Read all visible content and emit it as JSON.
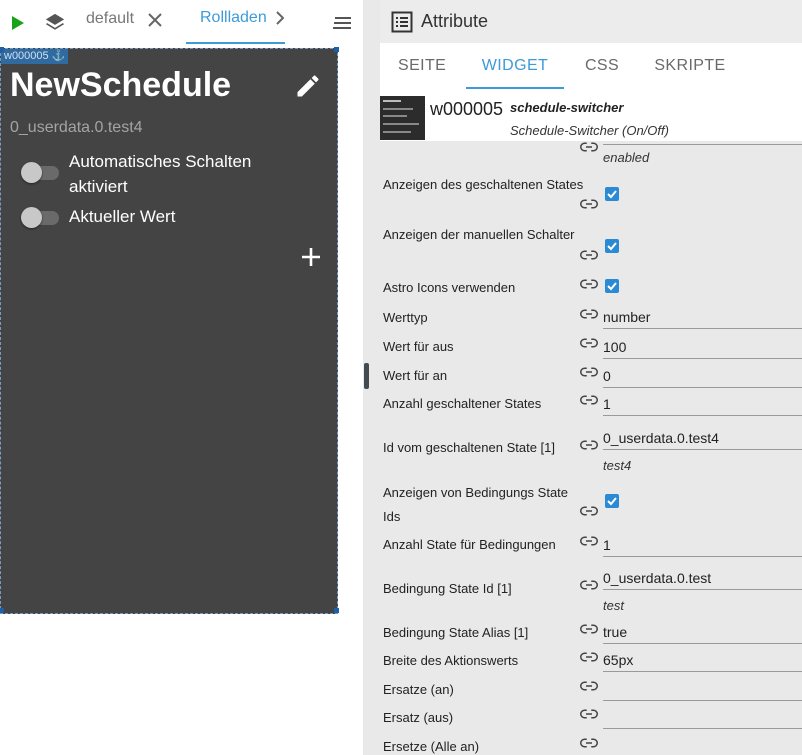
{
  "left": {
    "tabs": [
      {
        "label": "default",
        "closable": true,
        "active": false
      },
      {
        "label": "Rollladen",
        "active": true
      }
    ],
    "widget": {
      "tag": "w000005",
      "title": "NewSchedule",
      "subtitle": "0_userdata.0.test4",
      "toggles": [
        {
          "label": "Automatisches Schalten aktiviert",
          "on": false
        },
        {
          "label": "Aktueller Wert",
          "on": false
        }
      ]
    }
  },
  "right": {
    "title": "Attribute",
    "tabs": [
      "SEITE",
      "WIDGET",
      "CSS",
      "SKRIPTE"
    ],
    "active_tab": "WIDGET",
    "widget_id": "w000005",
    "widget_set": "schedule-switcher",
    "widget_name": "Schedule-Switcher (On/Off)",
    "props": [
      {
        "label": "",
        "value": "",
        "sub": "enabled"
      },
      {
        "label": "Anzeigen des geschaltenen States",
        "checked": true
      },
      {
        "label": "Anzeigen der manuellen Schalter",
        "checked": true
      },
      {
        "label": "Astro Icons verwenden",
        "checked": true
      },
      {
        "label": "Werttyp",
        "value": "number"
      },
      {
        "label": "Wert für aus",
        "value": "100"
      },
      {
        "label": "Wert für an",
        "value": "0"
      },
      {
        "label": "Anzahl geschaltener States",
        "value": "1"
      },
      {
        "label": "Id vom geschaltenen State [1]",
        "value": "0_userdata.0.test4",
        "sub": "test4"
      },
      {
        "label": "Anzeigen von Bedingungs State Ids",
        "checked": true
      },
      {
        "label": "Anzahl State für Bedingungen",
        "value": "1"
      },
      {
        "label": "Bedingung State Id [1]",
        "value": "0_userdata.0.test",
        "sub": "test"
      },
      {
        "label": "Bedingung State Alias [1]",
        "value": "true"
      },
      {
        "label": "Breite des Aktionswerts",
        "value": "65px"
      },
      {
        "label": "Ersatze (an)",
        "value": ""
      },
      {
        "label": "Ersatz (aus)",
        "value": ""
      },
      {
        "label": "Ersetze (Alle an)",
        "value": ""
      }
    ]
  },
  "colors": {
    "accent": "#3d9bd8",
    "play": "#1aa31a",
    "widget_bg": "#444444",
    "checkbox": "#2a8ad4"
  }
}
